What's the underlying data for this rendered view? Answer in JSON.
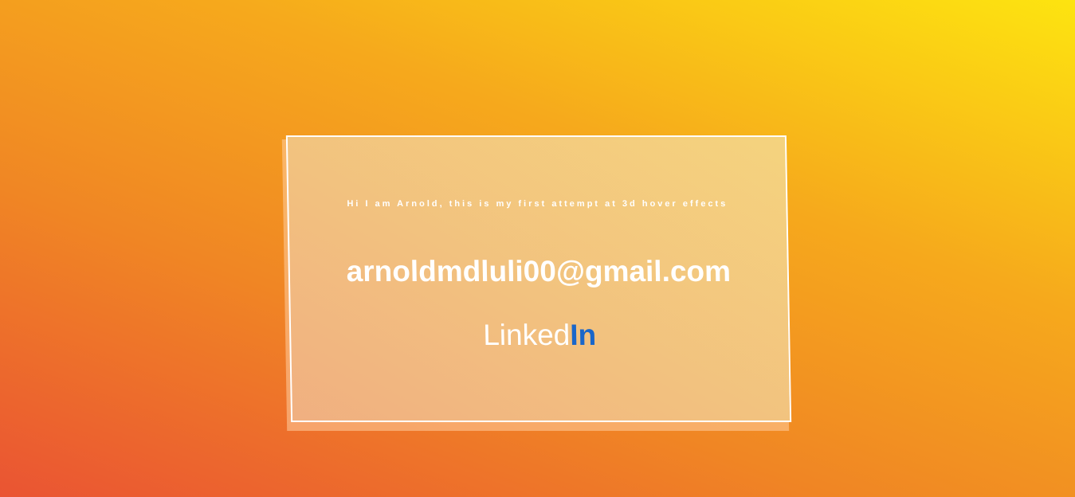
{
  "card": {
    "intro": "Hi I am Arnold, this is my first attempt at 3d hover effects",
    "email": "arnoldmdluli00@gmail.com",
    "linkedin_main": "Linked",
    "linkedin_accent": "In"
  },
  "colors": {
    "gradient_start": "#ea5433",
    "gradient_end": "#fde410",
    "linkedin_accent": "#1a66c9",
    "text": "#ffffff"
  }
}
